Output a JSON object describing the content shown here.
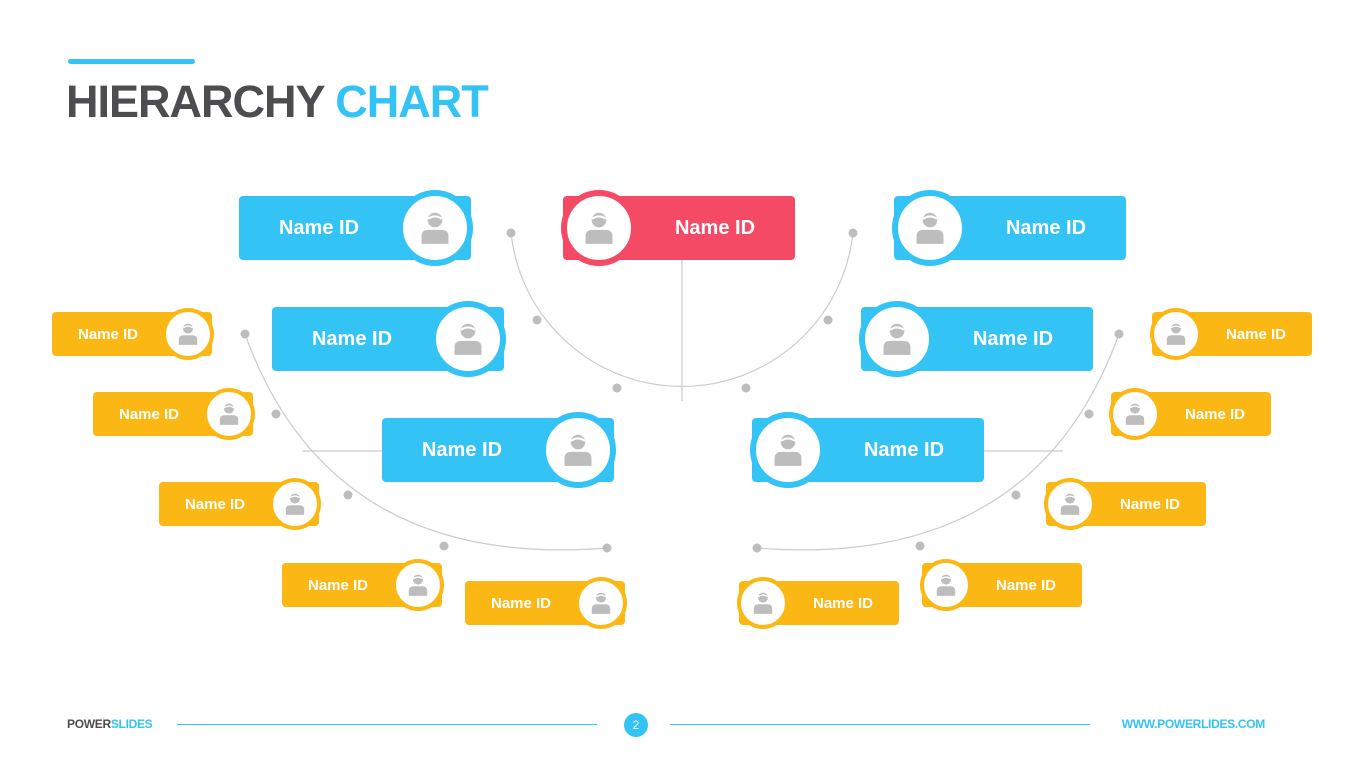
{
  "header": {
    "title_part1": "HIERARCHY",
    "title_part2": "CHART"
  },
  "colors": {
    "accent": "#33C3F5",
    "root": "#F44A65",
    "level1": "#33C3F5",
    "level2": "#FBB714",
    "connector": "#CCCCCC",
    "dot": "#BDBDBD",
    "avatar": "#BDBDBD"
  },
  "root": {
    "label": "Name ID",
    "icon": "user-avatar-icon"
  },
  "level1": [
    {
      "label": "Name ID",
      "side": "left",
      "icon": "user-avatar-icon"
    },
    {
      "label": "Name ID",
      "side": "left",
      "icon": "user-avatar-icon"
    },
    {
      "label": "Name ID",
      "side": "left",
      "icon": "user-avatar-icon"
    },
    {
      "label": "Name ID",
      "side": "right",
      "icon": "user-avatar-icon"
    },
    {
      "label": "Name ID",
      "side": "right",
      "icon": "user-avatar-icon"
    },
    {
      "label": "Name ID",
      "side": "right",
      "icon": "user-avatar-icon"
    }
  ],
  "level2": [
    {
      "label": "Name ID",
      "side": "left",
      "icon": "user-avatar-icon"
    },
    {
      "label": "Name ID",
      "side": "left",
      "icon": "user-avatar-icon"
    },
    {
      "label": "Name ID",
      "side": "left",
      "icon": "user-avatar-icon"
    },
    {
      "label": "Name ID",
      "side": "left",
      "icon": "user-avatar-icon"
    },
    {
      "label": "Name ID",
      "side": "left",
      "icon": "user-avatar-icon"
    },
    {
      "label": "Name ID",
      "side": "right",
      "icon": "user-avatar-icon"
    },
    {
      "label": "Name ID",
      "side": "right",
      "icon": "user-avatar-icon"
    },
    {
      "label": "Name ID",
      "side": "right",
      "icon": "user-avatar-icon"
    },
    {
      "label": "Name ID",
      "side": "right",
      "icon": "user-avatar-icon"
    },
    {
      "label": "Name ID",
      "side": "right",
      "icon": "user-avatar-icon"
    }
  ],
  "footer": {
    "brand_part1": "POWER",
    "brand_part2": "SLIDES",
    "page_number": "2",
    "website": "WWW.POWERLIDES.COM"
  }
}
